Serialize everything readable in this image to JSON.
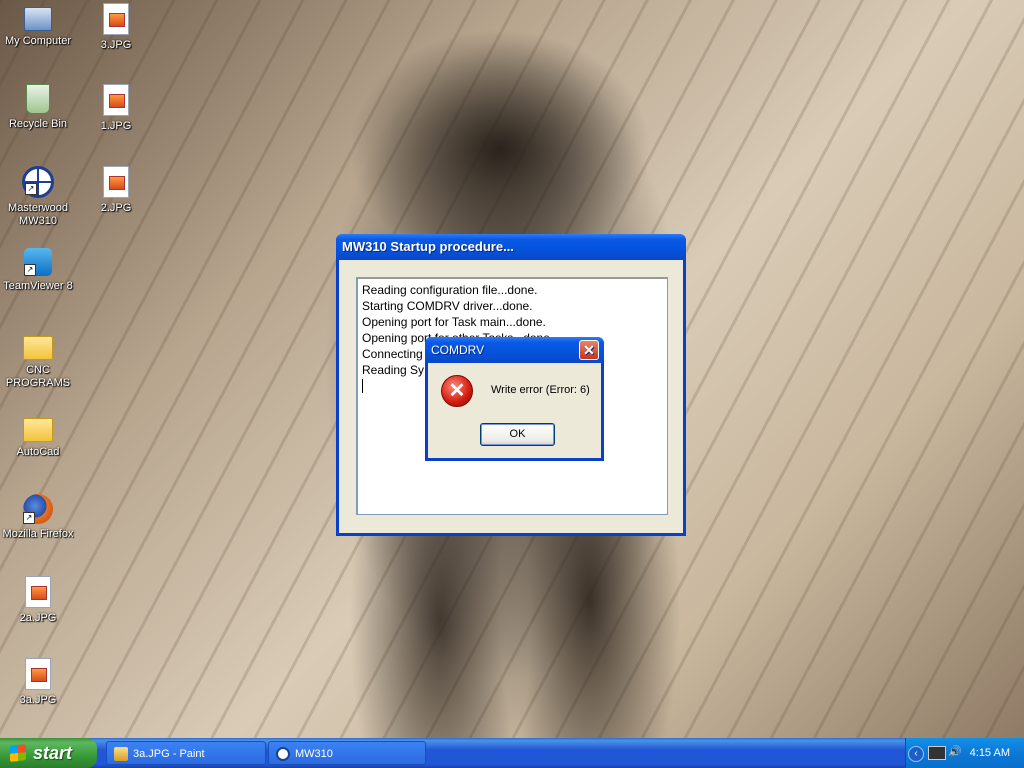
{
  "desktop": {
    "icons": [
      {
        "label": "My Computer"
      },
      {
        "label": "3.JPG"
      },
      {
        "label": "Recycle Bin"
      },
      {
        "label": "1.JPG"
      },
      {
        "label": "Masterwood MW310"
      },
      {
        "label": "2.JPG"
      },
      {
        "label": "TeamViewer 8"
      },
      {
        "label": "CNC PROGRAMS"
      },
      {
        "label": "AutoCad"
      },
      {
        "label": "Mozilla Firefox"
      },
      {
        "label": "2a.JPG"
      },
      {
        "label": "3a.JPG"
      }
    ]
  },
  "main_window": {
    "title": "MW310 Startup procedure...",
    "log_lines": [
      "Reading configuration file...done.",
      "Starting COMDRV driver...done.",
      "Opening port for Task main...done.",
      "Opening port for other Tasks...done.",
      "Connecting",
      "Reading Sy"
    ]
  },
  "error_dialog": {
    "title": "COMDRV",
    "close_glyph": "✕",
    "icon_glyph": "✕",
    "message": "Write error (Error: 6)",
    "ok_label": "OK"
  },
  "taskbar": {
    "start_label": "start",
    "buttons": [
      {
        "label": "3a.JPG - Paint"
      },
      {
        "label": "MW310"
      }
    ],
    "tray_arrow": "‹",
    "volume_glyph": "🔊",
    "clock": "4:15 AM"
  }
}
